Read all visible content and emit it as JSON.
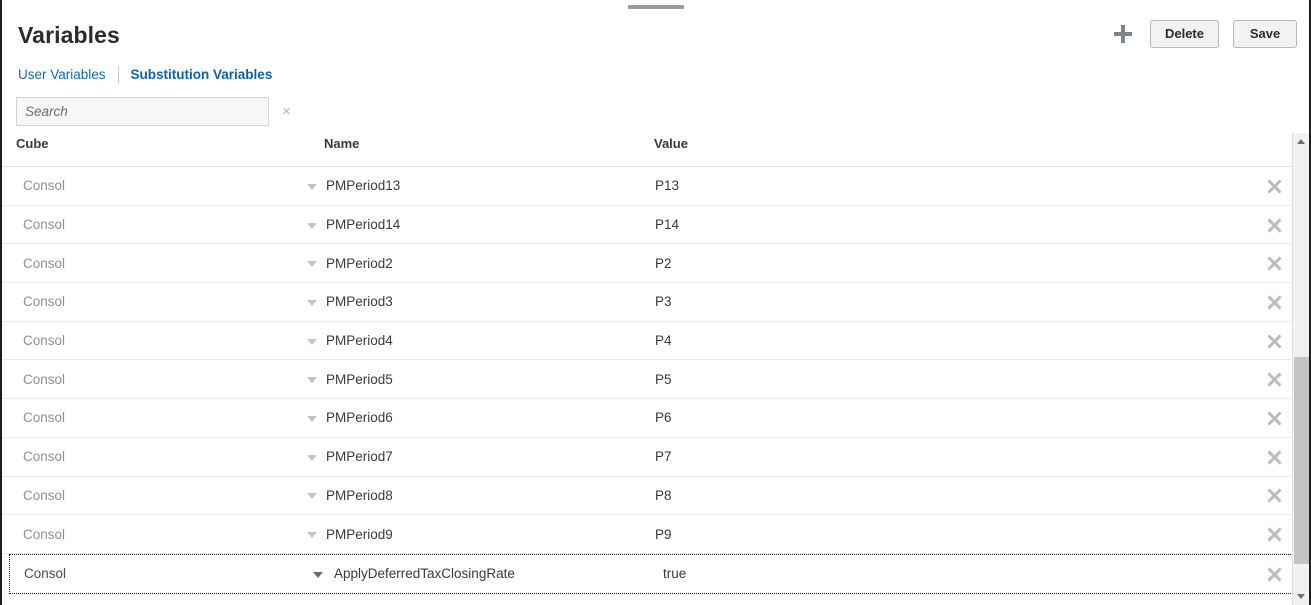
{
  "window": {
    "drag_handle": "drag-handle"
  },
  "header": {
    "title": "Variables",
    "add_icon": "plus-icon",
    "delete_label": "Delete",
    "save_label": "Save"
  },
  "tabs": [
    {
      "label": "User Variables",
      "active": false
    },
    {
      "label": "Substitution Variables",
      "active": true
    }
  ],
  "search": {
    "value": "",
    "placeholder": "Search",
    "clear_label": "×",
    "clear_icon": "clear-icon"
  },
  "table": {
    "columns": [
      "Cube",
      "Name",
      "Value"
    ],
    "rows": [
      {
        "cube": "Consol",
        "name": "PMPeriod13",
        "value": "P13",
        "focused": false
      },
      {
        "cube": "Consol",
        "name": "PMPeriod14",
        "value": "P14",
        "focused": false
      },
      {
        "cube": "Consol",
        "name": "PMPeriod2",
        "value": "P2",
        "focused": false
      },
      {
        "cube": "Consol",
        "name": "PMPeriod3",
        "value": "P3",
        "focused": false
      },
      {
        "cube": "Consol",
        "name": "PMPeriod4",
        "value": "P4",
        "focused": false
      },
      {
        "cube": "Consol",
        "name": "PMPeriod5",
        "value": "P5",
        "focused": false
      },
      {
        "cube": "Consol",
        "name": "PMPeriod6",
        "value": "P6",
        "focused": false
      },
      {
        "cube": "Consol",
        "name": "PMPeriod7",
        "value": "P7",
        "focused": false
      },
      {
        "cube": "Consol",
        "name": "PMPeriod8",
        "value": "P8",
        "focused": false
      },
      {
        "cube": "Consol",
        "name": "PMPeriod9",
        "value": "P9",
        "focused": false
      },
      {
        "cube": "Consol",
        "name": "ApplyDeferredTaxClosingRate",
        "value": "true",
        "focused": true
      }
    ]
  },
  "scrollbar": {
    "up_icon": "chevron-up-icon",
    "down_icon": "chevron-down-icon",
    "thumb": "scroll-thumb"
  },
  "colors": {
    "accent": "#0f6cb5",
    "text": "#3a3a3a",
    "muted": "#909090",
    "border": "#eaeaea",
    "button_bg": "#f2f2f2",
    "icon": "#7b858d"
  }
}
